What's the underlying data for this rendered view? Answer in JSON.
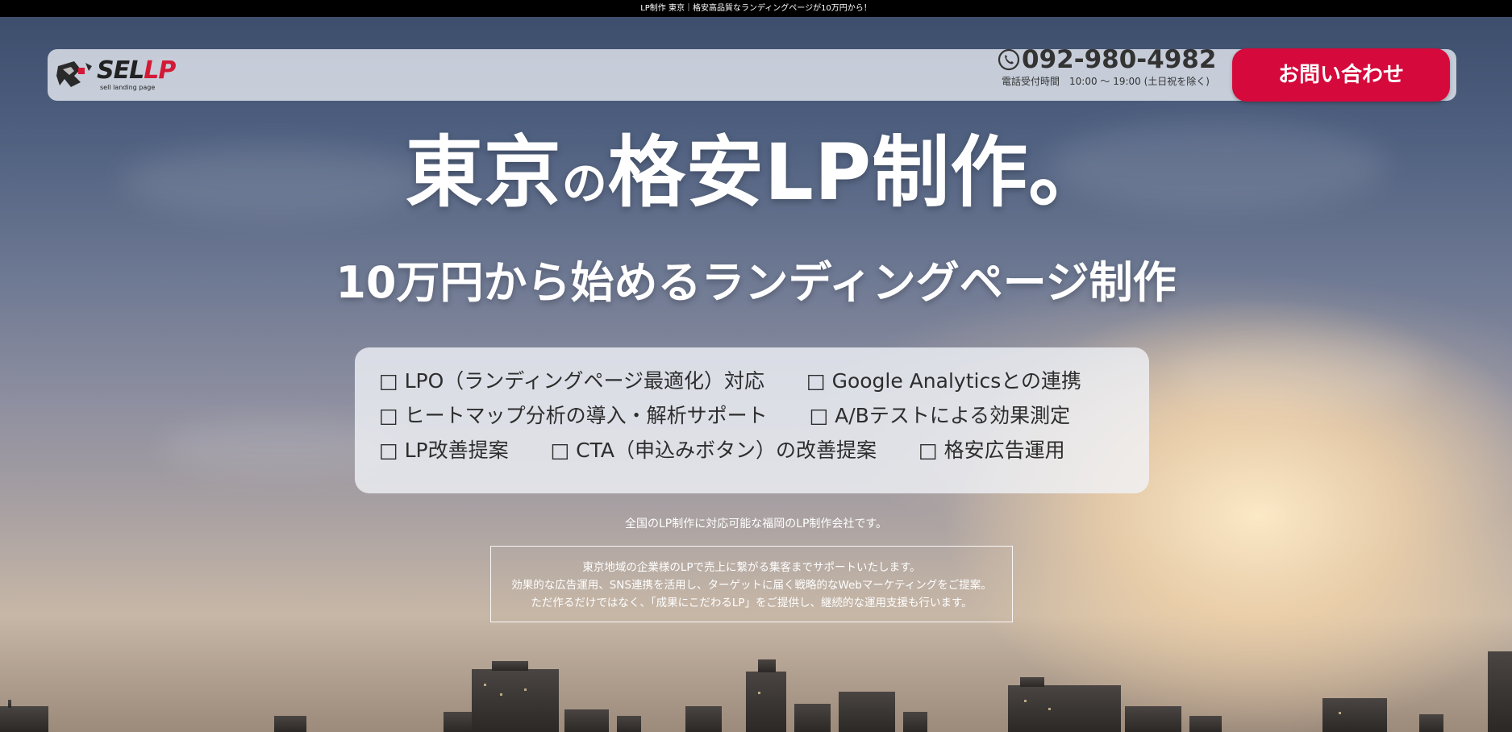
{
  "topbar": {
    "text": "LP制作 東京｜格安高品質なランディングページが10万円から！"
  },
  "header": {
    "logo": {
      "text_part1": "SEL",
      "text_part2": "LP",
      "subtitle": "sell landing page"
    },
    "phone": {
      "number": "092-980-4982",
      "hours": "電話受付時間　10:00 ～ 19:00 (土日祝を除く)"
    },
    "contact_button": "お問い合わせ"
  },
  "hero": {
    "title_part1": "東京",
    "title_particle": "の",
    "title_part2": "格安LP制作。",
    "subtitle": "10万円から始めるランディングページ制作"
  },
  "features": {
    "rows": [
      [
        "□ LPO（ランディングページ最適化）対応",
        "□ Google Analyticsとの連携"
      ],
      [
        "□ ヒートマップ分析の導入・解析サポート",
        "□ A/Bテストによる効果測定"
      ],
      [
        "□ LP改善提案",
        "□ CTA（申込みボタン）の改善提案",
        "□ 格安広告運用"
      ]
    ]
  },
  "tagline": "全国のLP制作に対応可能な福岡のLP制作会社です。",
  "description": {
    "line1": "東京地域の企業様のLPで売上に繋がる集客までサポートいたします。",
    "line2": "効果的な広告運用、SNS連携を活用し、ターゲットに届く戦略的なWebマーケティングをご提案。",
    "line3": "ただ作るだけではなく、「成果にこだわるLP」をご提供し、継続的な運用支援も行います。"
  },
  "colors": {
    "accent": "#d5093b",
    "logo_red": "#d21a36",
    "topbar": "#000000"
  },
  "icons": {
    "phone": "phone-icon",
    "logo": "logo-icon"
  }
}
